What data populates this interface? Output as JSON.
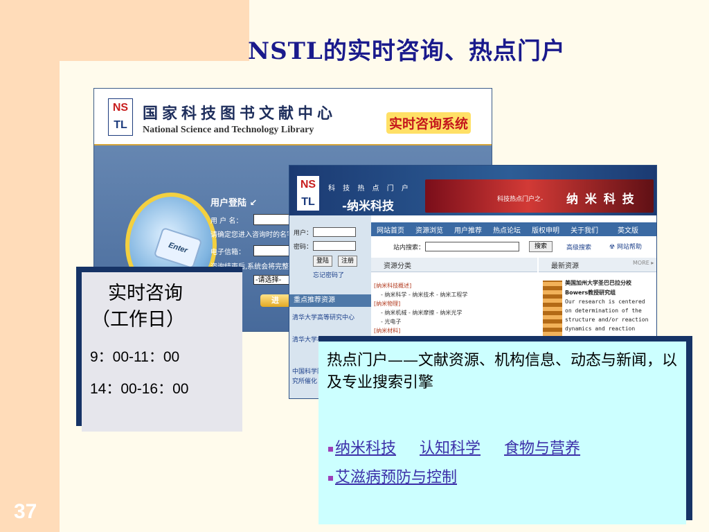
{
  "slide": {
    "title": "NSTL的实时咨询、热点门户",
    "page_number": "37"
  },
  "screenshot1": {
    "logo_letters": [
      "NS",
      "TL"
    ],
    "org_name_cn": "国家科技图书文献中心",
    "org_name_en": "National Science and Technology Library",
    "system_name": "实时咨询系统",
    "login_title": "用户登陆 ↙",
    "username_label": "用 户 名：",
    "notice": "请确定您进入咨询时的名字",
    "email_label": "电子信箱：",
    "after_notice": "咨询结束后,系统会将完整",
    "select_value": "-请选择-",
    "enter_key": "Enter",
    "go_button": "进"
  },
  "screenshot2": {
    "logo_letters": [
      "NS",
      "TL"
    ],
    "subtitle": "科 技 热 点 门 户",
    "portal_name": "-纳米科技",
    "banner_small": "科技热点门户之-",
    "banner_big": "纳 米 科 技",
    "user_label": "用户：",
    "password_label": "密码：",
    "login_button": "登陆",
    "register_button": "注册",
    "forgot_password": "忘记密码了",
    "recommend_title": "重点推荐资源",
    "recommend_items": [
      "清华大学高等研究中心",
      "清华大学材料科学与工程系",
      "中国科学院",
      "究所催化"
    ],
    "nav_items": [
      "网站首页",
      "资源浏览",
      "用户推荐",
      "热点论坛",
      "版权申明",
      "关于我们",
      "英文版"
    ],
    "search_label": "站内搜索：",
    "search_button": "搜索",
    "advanced_search": "高级搜索",
    "help": "网站帮助",
    "resource_section": "资源分类",
    "news_section": "最新资源",
    "more": "MORE ▸",
    "categories": [
      {
        "title": "[纳米科技概述]",
        "sub": "- 纳米科学 - 纳米技术 - 纳米工程学"
      },
      {
        "title": "[纳米物理]",
        "sub": "- 纳米机械 - 纳米摩擦 - 纳米光学"
      },
      {
        "extra": "- 光电子"
      },
      {
        "title": "[纳米材料]"
      }
    ],
    "news_lines": [
      "美国加州大学圣巴巴拉分校",
      "Bowers教授研究组",
      "Our research is centered",
      "on determination of the",
      "structure and/or reaction",
      "dynamics and reaction"
    ]
  },
  "box1": {
    "title_line1": "实时咨询",
    "title_line2": "（工作日）",
    "time1": "9：00-11：00",
    "time2": "14：00-16：00"
  },
  "box2": {
    "description": "热点门户——文献资源、机构信息、动态与新闻，以及专业搜索引擎",
    "links_row1": [
      "纳米科技",
      "认知科学",
      "食物与营养"
    ],
    "links_row2": [
      "艾滋病预防与控制"
    ]
  },
  "colors": {
    "title": "#1a1a8c",
    "background": "#fffbec",
    "band": "#ffdcb9",
    "box2": "#ccffff",
    "link": "#3b2ea8"
  }
}
